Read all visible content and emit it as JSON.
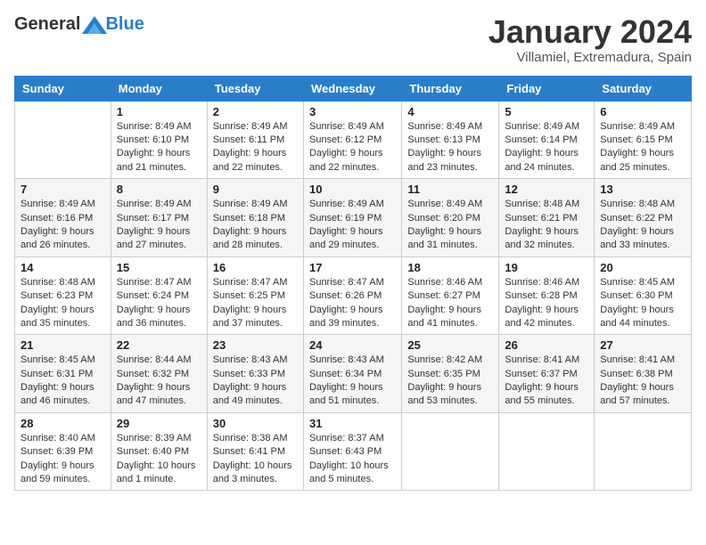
{
  "logo": {
    "general": "General",
    "blue": "Blue"
  },
  "header": {
    "title": "January 2024",
    "subtitle": "Villamiel, Extremadura, Spain"
  },
  "days_of_week": [
    "Sunday",
    "Monday",
    "Tuesday",
    "Wednesday",
    "Thursday",
    "Friday",
    "Saturday"
  ],
  "weeks": [
    [
      {
        "day": "",
        "sunrise": "",
        "sunset": "",
        "daylight": ""
      },
      {
        "day": "1",
        "sunrise": "Sunrise: 8:49 AM",
        "sunset": "Sunset: 6:10 PM",
        "daylight": "Daylight: 9 hours and 21 minutes."
      },
      {
        "day": "2",
        "sunrise": "Sunrise: 8:49 AM",
        "sunset": "Sunset: 6:11 PM",
        "daylight": "Daylight: 9 hours and 22 minutes."
      },
      {
        "day": "3",
        "sunrise": "Sunrise: 8:49 AM",
        "sunset": "Sunset: 6:12 PM",
        "daylight": "Daylight: 9 hours and 22 minutes."
      },
      {
        "day": "4",
        "sunrise": "Sunrise: 8:49 AM",
        "sunset": "Sunset: 6:13 PM",
        "daylight": "Daylight: 9 hours and 23 minutes."
      },
      {
        "day": "5",
        "sunrise": "Sunrise: 8:49 AM",
        "sunset": "Sunset: 6:14 PM",
        "daylight": "Daylight: 9 hours and 24 minutes."
      },
      {
        "day": "6",
        "sunrise": "Sunrise: 8:49 AM",
        "sunset": "Sunset: 6:15 PM",
        "daylight": "Daylight: 9 hours and 25 minutes."
      }
    ],
    [
      {
        "day": "7",
        "sunrise": "Sunrise: 8:49 AM",
        "sunset": "Sunset: 6:16 PM",
        "daylight": "Daylight: 9 hours and 26 minutes."
      },
      {
        "day": "8",
        "sunrise": "Sunrise: 8:49 AM",
        "sunset": "Sunset: 6:17 PM",
        "daylight": "Daylight: 9 hours and 27 minutes."
      },
      {
        "day": "9",
        "sunrise": "Sunrise: 8:49 AM",
        "sunset": "Sunset: 6:18 PM",
        "daylight": "Daylight: 9 hours and 28 minutes."
      },
      {
        "day": "10",
        "sunrise": "Sunrise: 8:49 AM",
        "sunset": "Sunset: 6:19 PM",
        "daylight": "Daylight: 9 hours and 29 minutes."
      },
      {
        "day": "11",
        "sunrise": "Sunrise: 8:49 AM",
        "sunset": "Sunset: 6:20 PM",
        "daylight": "Daylight: 9 hours and 31 minutes."
      },
      {
        "day": "12",
        "sunrise": "Sunrise: 8:48 AM",
        "sunset": "Sunset: 6:21 PM",
        "daylight": "Daylight: 9 hours and 32 minutes."
      },
      {
        "day": "13",
        "sunrise": "Sunrise: 8:48 AM",
        "sunset": "Sunset: 6:22 PM",
        "daylight": "Daylight: 9 hours and 33 minutes."
      }
    ],
    [
      {
        "day": "14",
        "sunrise": "Sunrise: 8:48 AM",
        "sunset": "Sunset: 6:23 PM",
        "daylight": "Daylight: 9 hours and 35 minutes."
      },
      {
        "day": "15",
        "sunrise": "Sunrise: 8:47 AM",
        "sunset": "Sunset: 6:24 PM",
        "daylight": "Daylight: 9 hours and 36 minutes."
      },
      {
        "day": "16",
        "sunrise": "Sunrise: 8:47 AM",
        "sunset": "Sunset: 6:25 PM",
        "daylight": "Daylight: 9 hours and 37 minutes."
      },
      {
        "day": "17",
        "sunrise": "Sunrise: 8:47 AM",
        "sunset": "Sunset: 6:26 PM",
        "daylight": "Daylight: 9 hours and 39 minutes."
      },
      {
        "day": "18",
        "sunrise": "Sunrise: 8:46 AM",
        "sunset": "Sunset: 6:27 PM",
        "daylight": "Daylight: 9 hours and 41 minutes."
      },
      {
        "day": "19",
        "sunrise": "Sunrise: 8:46 AM",
        "sunset": "Sunset: 6:28 PM",
        "daylight": "Daylight: 9 hours and 42 minutes."
      },
      {
        "day": "20",
        "sunrise": "Sunrise: 8:45 AM",
        "sunset": "Sunset: 6:30 PM",
        "daylight": "Daylight: 9 hours and 44 minutes."
      }
    ],
    [
      {
        "day": "21",
        "sunrise": "Sunrise: 8:45 AM",
        "sunset": "Sunset: 6:31 PM",
        "daylight": "Daylight: 9 hours and 46 minutes."
      },
      {
        "day": "22",
        "sunrise": "Sunrise: 8:44 AM",
        "sunset": "Sunset: 6:32 PM",
        "daylight": "Daylight: 9 hours and 47 minutes."
      },
      {
        "day": "23",
        "sunrise": "Sunrise: 8:43 AM",
        "sunset": "Sunset: 6:33 PM",
        "daylight": "Daylight: 9 hours and 49 minutes."
      },
      {
        "day": "24",
        "sunrise": "Sunrise: 8:43 AM",
        "sunset": "Sunset: 6:34 PM",
        "daylight": "Daylight: 9 hours and 51 minutes."
      },
      {
        "day": "25",
        "sunrise": "Sunrise: 8:42 AM",
        "sunset": "Sunset: 6:35 PM",
        "daylight": "Daylight: 9 hours and 53 minutes."
      },
      {
        "day": "26",
        "sunrise": "Sunrise: 8:41 AM",
        "sunset": "Sunset: 6:37 PM",
        "daylight": "Daylight: 9 hours and 55 minutes."
      },
      {
        "day": "27",
        "sunrise": "Sunrise: 8:41 AM",
        "sunset": "Sunset: 6:38 PM",
        "daylight": "Daylight: 9 hours and 57 minutes."
      }
    ],
    [
      {
        "day": "28",
        "sunrise": "Sunrise: 8:40 AM",
        "sunset": "Sunset: 6:39 PM",
        "daylight": "Daylight: 9 hours and 59 minutes."
      },
      {
        "day": "29",
        "sunrise": "Sunrise: 8:39 AM",
        "sunset": "Sunset: 6:40 PM",
        "daylight": "Daylight: 10 hours and 1 minute."
      },
      {
        "day": "30",
        "sunrise": "Sunrise: 8:38 AM",
        "sunset": "Sunset: 6:41 PM",
        "daylight": "Daylight: 10 hours and 3 minutes."
      },
      {
        "day": "31",
        "sunrise": "Sunrise: 8:37 AM",
        "sunset": "Sunset: 6:43 PM",
        "daylight": "Daylight: 10 hours and 5 minutes."
      },
      {
        "day": "",
        "sunrise": "",
        "sunset": "",
        "daylight": ""
      },
      {
        "day": "",
        "sunrise": "",
        "sunset": "",
        "daylight": ""
      },
      {
        "day": "",
        "sunrise": "",
        "sunset": "",
        "daylight": ""
      }
    ]
  ]
}
